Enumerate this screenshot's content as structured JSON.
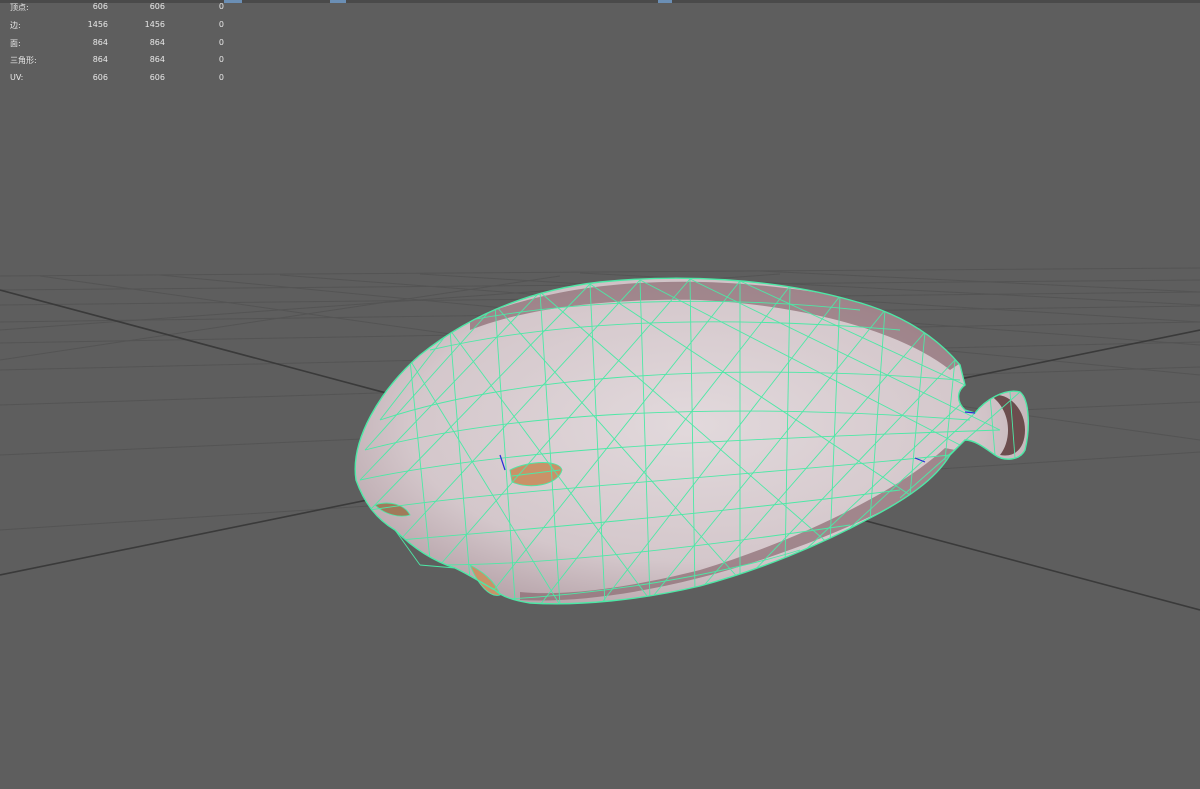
{
  "hud": {
    "rows": [
      {
        "label": "顶点:",
        "v1": "606",
        "v2": "606",
        "v3": "0"
      },
      {
        "label": "边:",
        "v1": "1456",
        "v2": "1456",
        "v3": "0"
      },
      {
        "label": "面:",
        "v1": "864",
        "v2": "864",
        "v3": "0"
      },
      {
        "label": "三角形:",
        "v1": "864",
        "v2": "864",
        "v3": "0"
      },
      {
        "label": "UV:",
        "v1": "606",
        "v2": "606",
        "v3": "0"
      }
    ]
  },
  "colors": {
    "background": "#5e5e5e",
    "grid": "#545454",
    "grid_axis": "#333333",
    "wireframe": "#4de8a6",
    "mesh_fill": "#d9cfd2",
    "hud_text": "#e8e8e8"
  },
  "viewport": {
    "model_object": "flatfish-icon",
    "display_mode": "wireframe-on-shaded"
  }
}
